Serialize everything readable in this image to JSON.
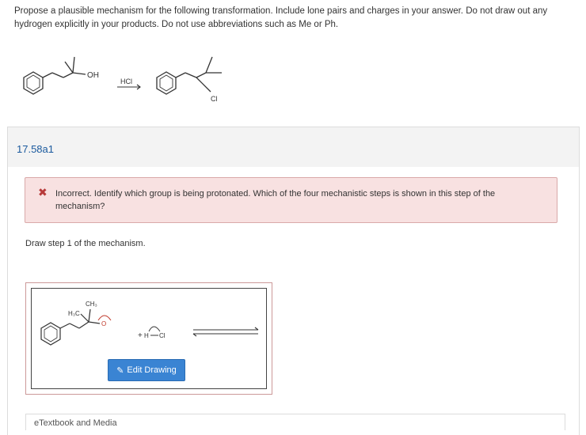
{
  "question": {
    "text": "Propose a plausible mechanism for the following transformation. Include lone pairs and charges in your answer. Do not draw out any hydrogen explicitly in your products. Do not use abbreviations such as Me or Ph."
  },
  "reaction": {
    "reactant_group": "OH",
    "reagent": "HCl",
    "product_group": "Cl"
  },
  "part": {
    "title": "17.58a1"
  },
  "feedback": {
    "icon": "close-icon",
    "text": "Incorrect. Identify which group is being protonated. Which of the four mechanistic steps is shown in this step of the mechanism?"
  },
  "step": {
    "label": "Draw step 1 of the mechanism."
  },
  "canvas": {
    "methyl_top": "CH₃",
    "methyl_left": "H₃C",
    "oxygen": "O",
    "hydrogen": "H",
    "chlorine": "Cl",
    "plus": "+",
    "edit_button": "Edit Drawing"
  },
  "textbook": {
    "label": "eTextbook and Media"
  },
  "colors": {
    "accent": "#3a84d3",
    "error_bg": "#f8e1e1",
    "error_border": "#d9a9a9",
    "error_icon": "#b73a3a",
    "title": "#1b5a9e"
  }
}
